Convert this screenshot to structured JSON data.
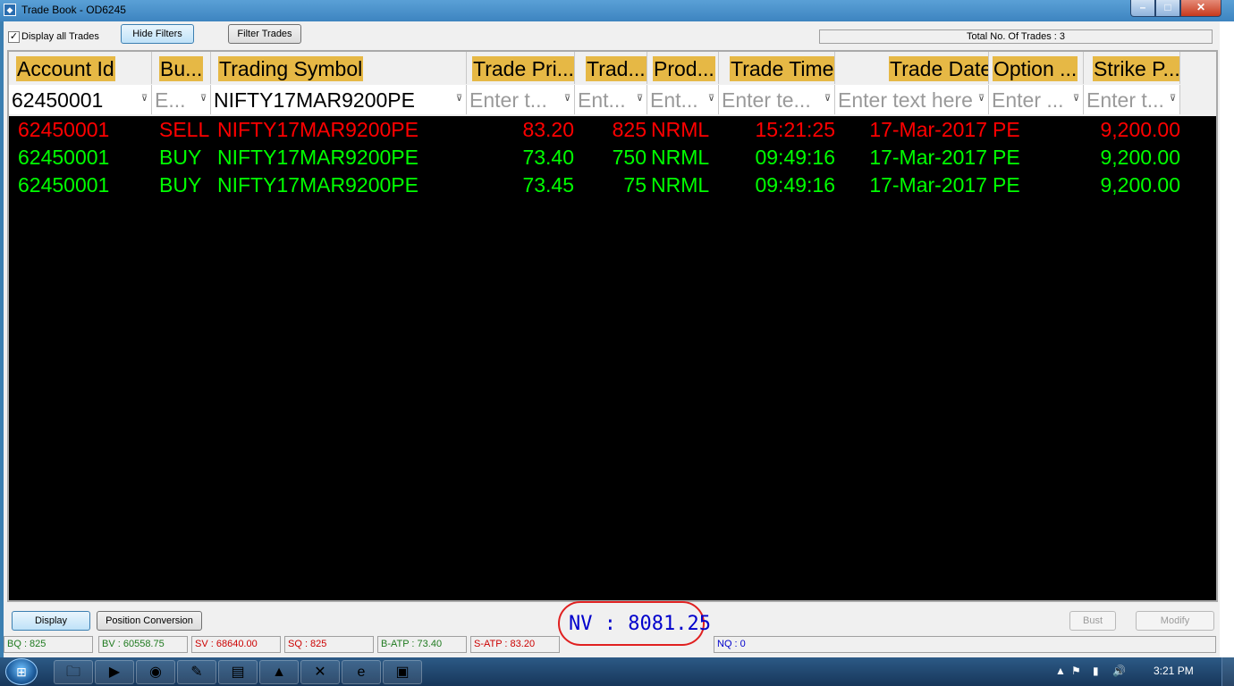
{
  "window": {
    "title": "Trade Book - OD6245"
  },
  "toolbar": {
    "display_all_label": "Display all Trades",
    "display_all_checked": "✓",
    "hide_filters": "Hide Filters",
    "filter_trades": "Filter Trades",
    "total_trades": "Total No. Of Trades : 3"
  },
  "grid": {
    "columns": [
      "Account Id",
      "Bu...",
      "Trading Symbol",
      "Trade Pri...",
      "Trad...",
      "Prod...",
      "Trade Time",
      "Trade Date",
      "Option ...",
      "Strike P..."
    ],
    "filters": [
      {
        "value": "62450001",
        "placeholder": false
      },
      {
        "value": "E...",
        "placeholder": true
      },
      {
        "value": "NIFTY17MAR9200PE",
        "placeholder": false
      },
      {
        "value": "Enter t...",
        "placeholder": true
      },
      {
        "value": "Ent...",
        "placeholder": true
      },
      {
        "value": "Ent...",
        "placeholder": true
      },
      {
        "value": "Enter te...",
        "placeholder": true
      },
      {
        "value": "Enter text here",
        "placeholder": true
      },
      {
        "value": "Enter ...",
        "placeholder": true
      },
      {
        "value": "Enter t...",
        "placeholder": true
      }
    ],
    "rows": [
      {
        "side": "sell",
        "cells": [
          "62450001",
          "SELL",
          "NIFTY17MAR9200PE",
          "83.20",
          "825",
          "NRML",
          "15:21:25",
          "17-Mar-2017",
          "PE",
          "9,200.00"
        ]
      },
      {
        "side": "buy",
        "cells": [
          "62450001",
          "BUY",
          "NIFTY17MAR9200PE",
          "73.40",
          "750",
          "NRML",
          "09:49:16",
          "17-Mar-2017",
          "PE",
          "9,200.00"
        ]
      },
      {
        "side": "buy",
        "cells": [
          "62450001",
          "BUY",
          "NIFTY17MAR9200PE",
          "73.45",
          "75",
          "NRML",
          "09:49:16",
          "17-Mar-2017",
          "PE",
          "9,200.00"
        ]
      }
    ]
  },
  "bottom": {
    "display": "Display",
    "position_conversion": "Position Conversion",
    "bust": "Bust",
    "modify": "Modify"
  },
  "status": {
    "bq": "BQ : 825",
    "bv": "BV : 60558.75",
    "sv": "SV : 68640.00",
    "sq": "SQ : 825",
    "batp": "B-ATP : 73.40",
    "satp": "S-ATP : 83.20",
    "nv": "NV : 8081.25",
    "nq": "NQ : 0"
  },
  "taskbar": {
    "clock": "3:21 PM"
  }
}
